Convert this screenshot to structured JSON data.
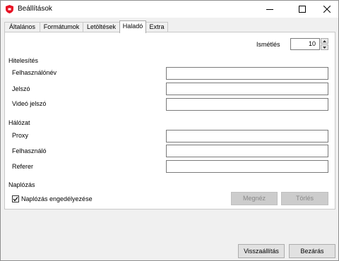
{
  "window": {
    "title": "Beállítások"
  },
  "tabs": [
    {
      "label": "Általános"
    },
    {
      "label": "Formátumok"
    },
    {
      "label": "Letöltések"
    },
    {
      "label": "Haladó",
      "active": true
    },
    {
      "label": "Extra"
    }
  ],
  "retries": {
    "label": "Ismétlés",
    "value": "10"
  },
  "auth": {
    "heading": "Hitelesítés",
    "username_label": "Felhasználónév",
    "username_value": "",
    "password_label": "Jelszó",
    "password_value": "",
    "video_password_label": "Videó jelszó",
    "video_password_value": ""
  },
  "network": {
    "heading": "Hálózat",
    "proxy_label": "Proxy",
    "proxy_value": "",
    "user_label": "Felhasználó",
    "user_value": "",
    "referer_label": "Referer",
    "referer_value": ""
  },
  "logging": {
    "heading": "Naplózás",
    "enable_label": "Naplózás engedélyezése",
    "enabled": true,
    "view_label": "Megnéz",
    "clear_label": "Törlés"
  },
  "footer": {
    "reset_label": "Visszaállítás",
    "close_label": "Bezárás"
  },
  "colors": {
    "app_icon": "#e81123",
    "disabled_button": "#cccccc",
    "disabled_text": "#888888"
  }
}
